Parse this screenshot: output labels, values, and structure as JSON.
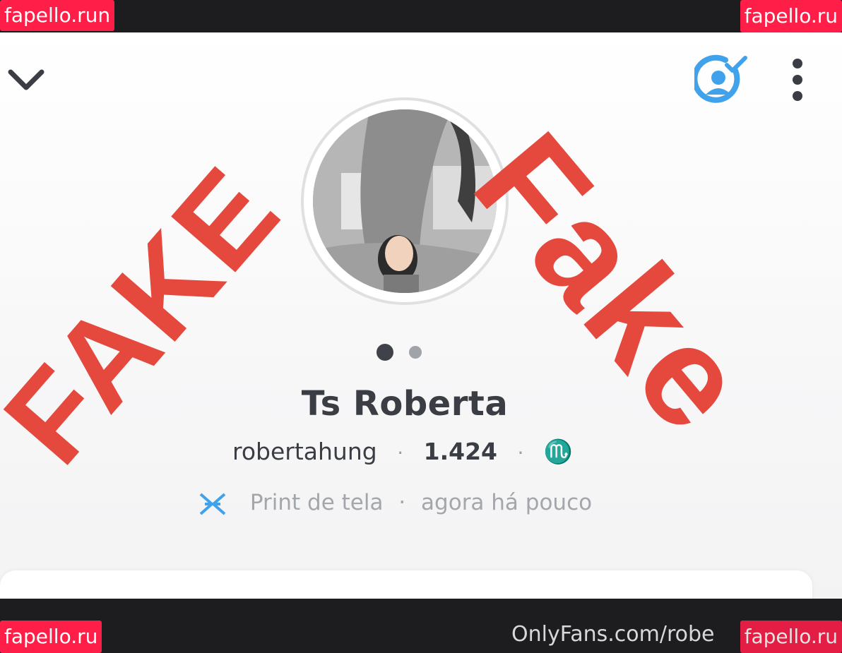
{
  "watermarks": {
    "top_left": "fapello.run",
    "top_right": "fapello.ru",
    "bottom_left": "fapello.ru",
    "bottom_right": "fapello.ru"
  },
  "footer_text": "OnlyFans.com/robe",
  "header": {
    "back_icon": "chevron-down-icon",
    "friend_icon": "add-friend-check-icon",
    "more_icon": "more-vertical-icon"
  },
  "profile": {
    "display_name": "Ts Roberta",
    "username": "robertahung",
    "score": "1.424",
    "zodiac": "♏",
    "separator": "·",
    "activity_icon": "screenshot-arrows-icon",
    "activity_label": "Print de tela",
    "activity_time": "agora há pouco"
  },
  "pager": {
    "count": 2,
    "active_index": 0
  },
  "stamps": {
    "left": "FAKE",
    "right": "Fake"
  },
  "colors": {
    "stamp_red": "#e5493e",
    "watermark_pink": "#ff1e48",
    "friend_blue": "#3fa2ea",
    "text_dark": "#3a3e44",
    "text_muted": "#a3a6ab"
  }
}
